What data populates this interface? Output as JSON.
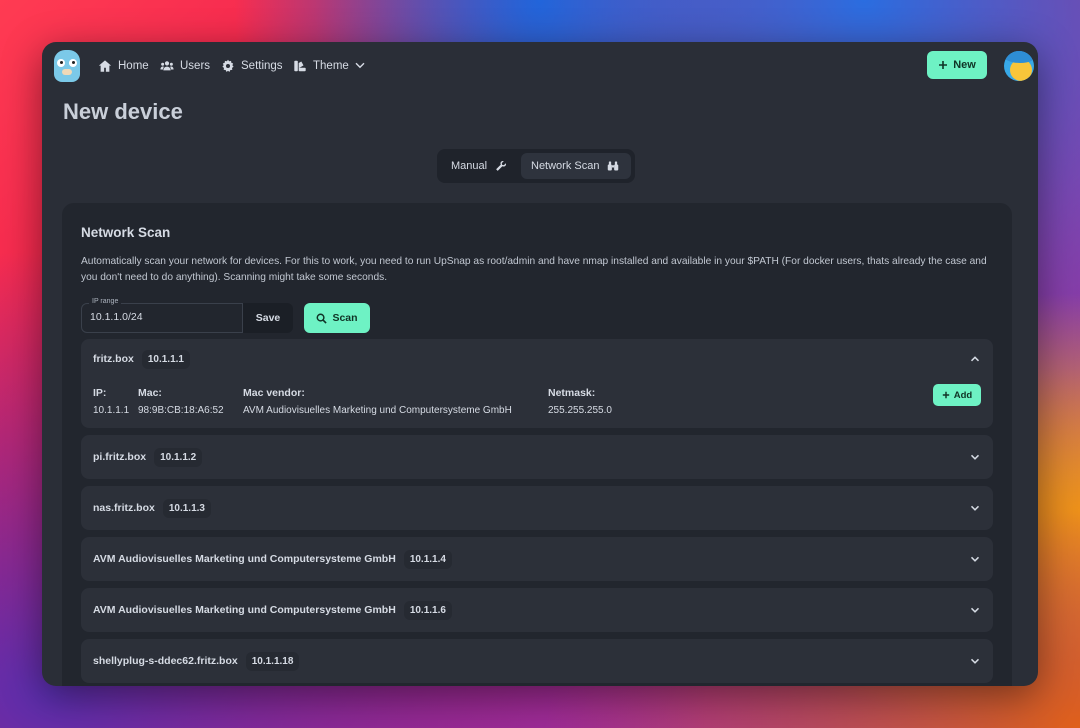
{
  "nav": {
    "items": [
      {
        "label": "Home",
        "icon": "home-icon"
      },
      {
        "label": "Users",
        "icon": "users-icon"
      },
      {
        "label": "Settings",
        "icon": "gear-icon"
      },
      {
        "label": "Theme",
        "icon": "palette-icon"
      }
    ],
    "new_button": "New"
  },
  "page": {
    "title": "New device"
  },
  "tabs": [
    {
      "label": "Manual",
      "icon": "wrench-icon",
      "active": false
    },
    {
      "label": "Network Scan",
      "icon": "binoculars-icon",
      "active": true
    }
  ],
  "scan": {
    "title": "Network Scan",
    "description": "Automatically scan your network for devices. For this to work, you need to run UpSnap as root/admin and have nmap installed and available in your $PATH (For docker users, thats already the case and you don't need to do anything). Scanning might take some seconds.",
    "ip_range_label": "IP range",
    "ip_range_value": "10.1.1.0/24",
    "save_label": "Save",
    "scan_label": "Scan"
  },
  "devices": [
    {
      "name": "fritz.box",
      "ip": "10.1.1.1",
      "expanded": true,
      "details": {
        "ip_label": "IP:",
        "ip": "10.1.1.1",
        "mac_label": "Mac:",
        "mac": "98:9B:CB:18:A6:52",
        "vendor_label": "Mac vendor:",
        "vendor": "AVM Audiovisuelles Marketing und Computersysteme GmbH",
        "netmask_label": "Netmask:",
        "netmask": "255.255.255.0"
      },
      "add_label": "Add"
    },
    {
      "name": "pi.fritz.box",
      "ip": "10.1.1.2",
      "expanded": false
    },
    {
      "name": "nas.fritz.box",
      "ip": "10.1.1.3",
      "expanded": false
    },
    {
      "name": "AVM Audiovisuelles Marketing und Computersysteme GmbH",
      "ip": "10.1.1.4",
      "expanded": false
    },
    {
      "name": "AVM Audiovisuelles Marketing und Computersysteme GmbH",
      "ip": "10.1.1.6",
      "expanded": false
    },
    {
      "name": "shellyplug-s-ddec62.fritz.box",
      "ip": "10.1.1.18",
      "expanded": false
    }
  ],
  "colors": {
    "accent": "#6ef2c4",
    "window_bg": "#2a2e37",
    "card_bg": "#22262e",
    "row_bg": "#2c3039"
  }
}
